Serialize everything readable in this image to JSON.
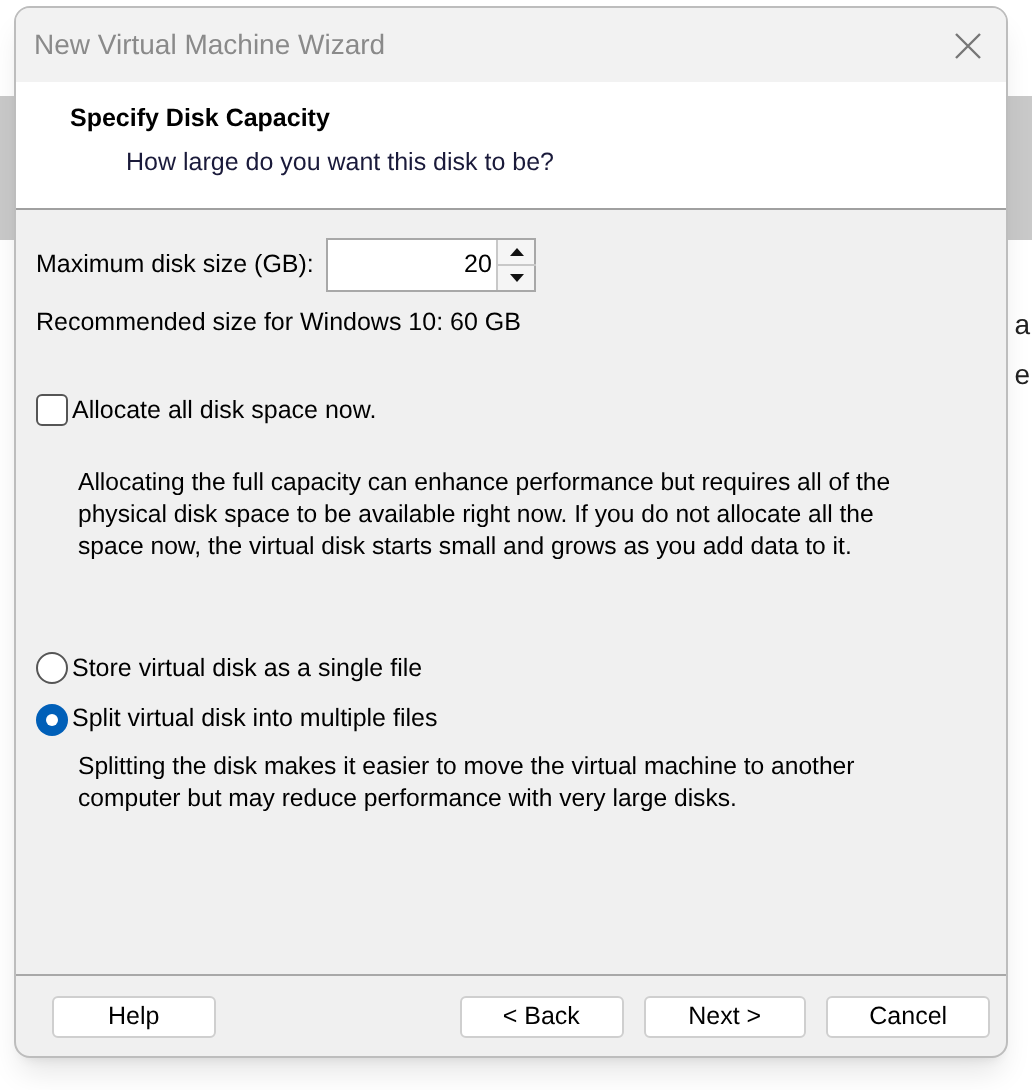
{
  "background": {
    "fragments": [
      "a",
      "e"
    ]
  },
  "window": {
    "title": "New Virtual Machine Wizard"
  },
  "header": {
    "title": "Specify Disk Capacity",
    "subtitle": "How large do you want this disk to be?"
  },
  "disk_size": {
    "label": "Maximum disk size (GB):",
    "value": "20"
  },
  "recommendation": "Recommended size for Windows 10: 60 GB",
  "allocate": {
    "label": "Allocate all disk space now.",
    "checked": false,
    "description": "Allocating the full capacity can enhance performance but requires all of the physical disk space to be available right now. If you do not allocate all the space now, the virtual disk starts small and grows as you add data to it."
  },
  "storage_options": [
    {
      "label": "Store virtual disk as a single file",
      "selected": false
    },
    {
      "label": "Split virtual disk into multiple files",
      "selected": true
    }
  ],
  "split_description": "Splitting the disk makes it easier to move the virtual machine to another computer but may reduce performance with very large disks.",
  "buttons": [
    "Help",
    "< Back",
    "Next >",
    "Cancel"
  ]
}
